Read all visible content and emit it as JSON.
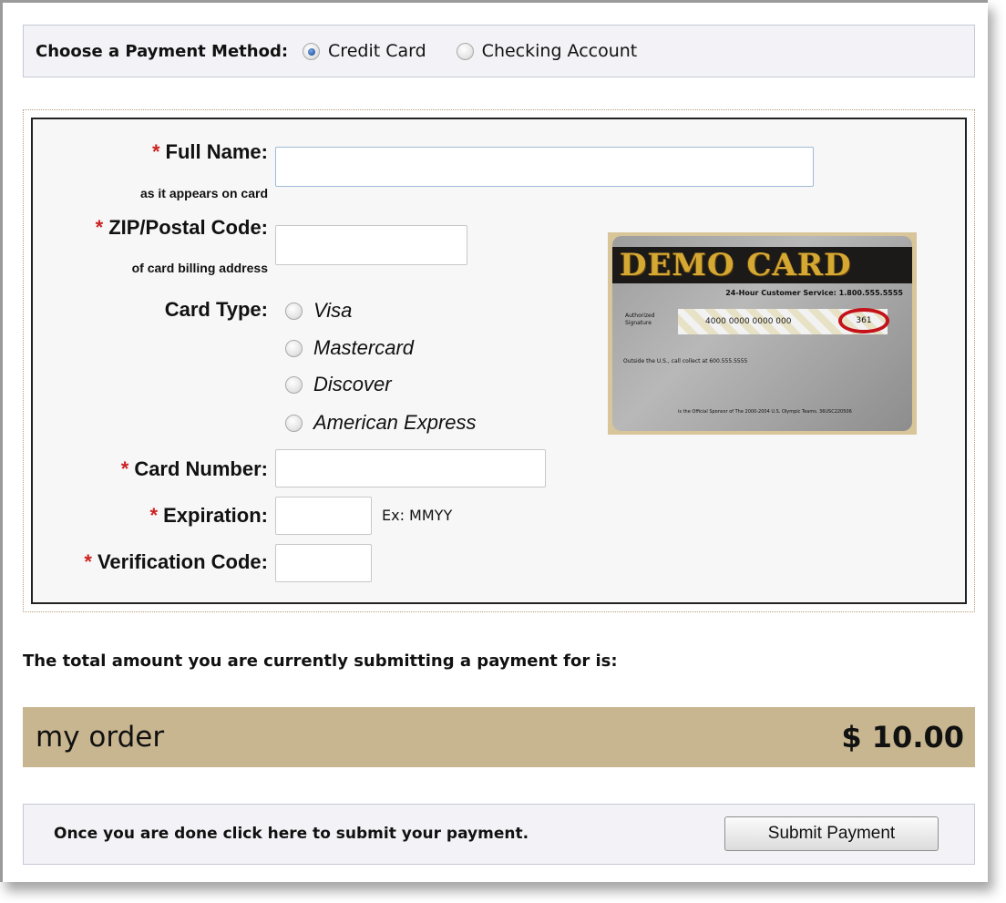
{
  "payment_method": {
    "label": "Choose a Payment Method:",
    "options": [
      {
        "label": "Credit Card",
        "selected": true
      },
      {
        "label": "Checking Account",
        "selected": false
      }
    ]
  },
  "form": {
    "required_marker": "*",
    "full_name": {
      "label": "Full Name:",
      "sublabel": "as it appears on card",
      "value": ""
    },
    "zip": {
      "label": "ZIP/Postal Code:",
      "sublabel": "of card billing address",
      "value": ""
    },
    "card_type": {
      "label": "Card Type:",
      "options": [
        {
          "label": "Visa",
          "selected": false
        },
        {
          "label": "Mastercard",
          "selected": false
        },
        {
          "label": "Discover",
          "selected": false
        },
        {
          "label": "American Express",
          "selected": false
        }
      ]
    },
    "card_number": {
      "label": "Card Number:",
      "value": ""
    },
    "expiration": {
      "label": "Expiration:",
      "value": "",
      "hint": "Ex: MMYY"
    },
    "verification": {
      "label": "Verification Code:",
      "value": ""
    }
  },
  "card_image": {
    "brand": "DEMO CARD",
    "service_line": "24-Hour Customer Service: 1.800.555.5555",
    "authorized": "Authorized Signature",
    "number": "4000 0000 0000 000",
    "code": "361",
    "outside": "Outside the U.S., call collect at 600.555.5555",
    "official": "is the Official Sponsor of The 2000-2004 U.S. Olympic Teams. 36USC220506"
  },
  "summary": {
    "total_label": "The total amount you are currently submitting a payment for is:",
    "order_name": "my order",
    "amount": "$ 10.00"
  },
  "submit": {
    "message": "Once you are done click here to submit your payment.",
    "button_label": "Submit Payment"
  },
  "colors": {
    "required": "#cc2222",
    "order_bar": "#c8b690",
    "panel_bg": "#f3f3f7"
  }
}
